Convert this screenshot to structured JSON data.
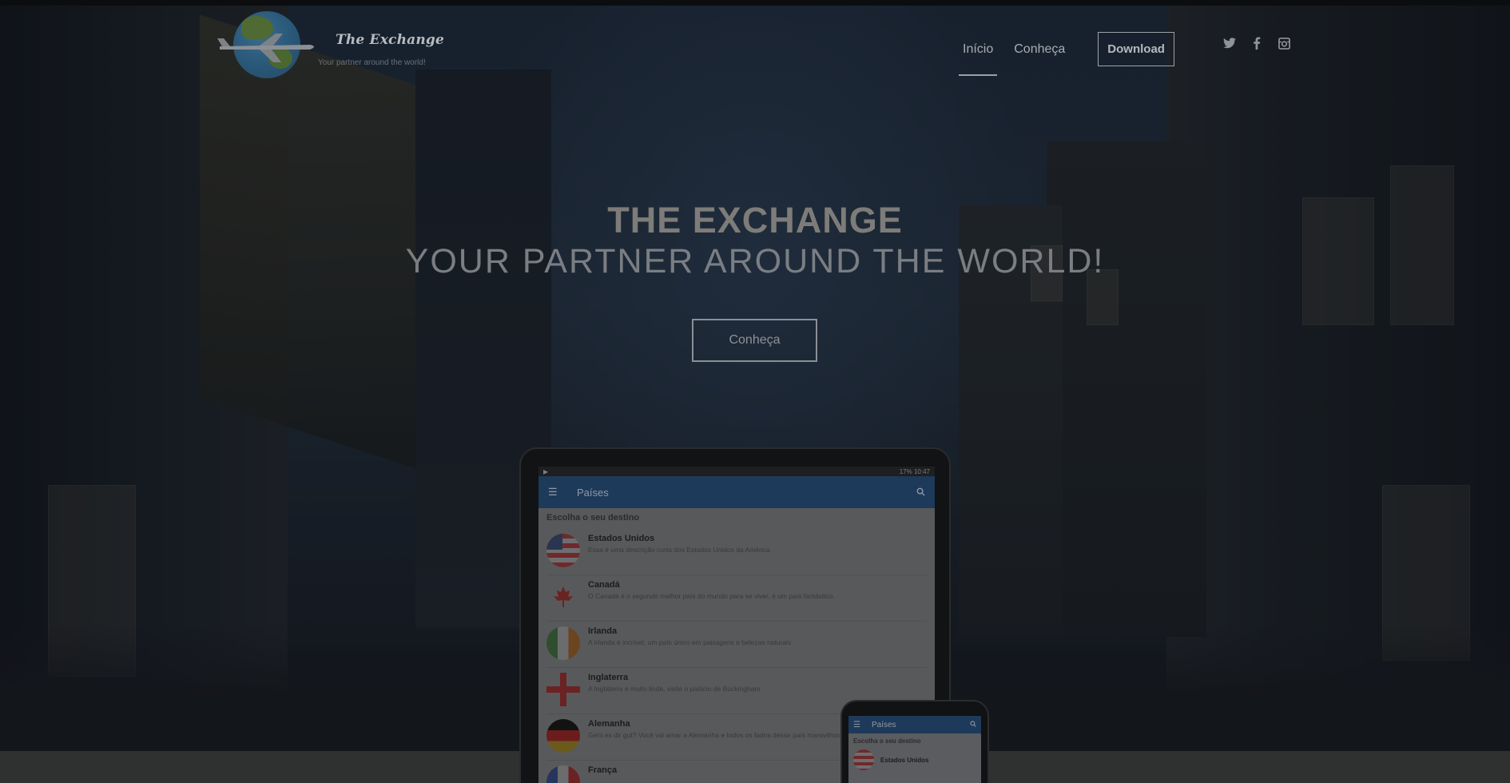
{
  "brand": {
    "name": "The Exchange",
    "tagline": "Your partner around the world!"
  },
  "nav": {
    "items": [
      {
        "label": "Início",
        "active": true
      },
      {
        "label": "Conheça",
        "active": false
      }
    ],
    "download_label": "Download"
  },
  "social": [
    {
      "icon": "twitter-icon",
      "glyph": "🐦"
    },
    {
      "icon": "facebook-icon",
      "glyph": "f"
    },
    {
      "icon": "instagram-icon",
      "glyph": "◘"
    }
  ],
  "hero": {
    "title": "THE EXCHANGE",
    "subtitle": "YOUR PARTNER AROUND THE WORLD!",
    "cta_label": "Conheça"
  },
  "tablet_app": {
    "status_time": "17% 10:47",
    "appbar_title": "Países",
    "list_header": "Escolha o seu destino",
    "countries": [
      {
        "name": "Estados Unidos",
        "desc": "Essa é uma descrição curta dos Estados Unidos da América",
        "flag": "us"
      },
      {
        "name": "Canadá",
        "desc": "O Canadá é o segundo melhor país do mundo para se viver, é um país fantástico.",
        "flag": "ca"
      },
      {
        "name": "Irlanda",
        "desc": "A Irlanda é incrível, um país único em paisagens e belezas naturais",
        "flag": "ie"
      },
      {
        "name": "Inglaterra",
        "desc": "A Inglaterra é muito linda, visite o palácio de Buckingham",
        "flag": "en"
      },
      {
        "name": "Alemanha",
        "desc": "Geht es dir gut? Você vai amar a Alemanha e todos os fados desse país maravilhoso",
        "flag": "de"
      },
      {
        "name": "França",
        "desc": "",
        "flag": "fr"
      }
    ]
  },
  "phone_app": {
    "appbar_title": "Países",
    "list_header": "Escolha o seu destino",
    "first_item": "Estados Unidos"
  },
  "colors": {
    "appbar": "#1e3a5a",
    "overlay": "#0c1018"
  }
}
